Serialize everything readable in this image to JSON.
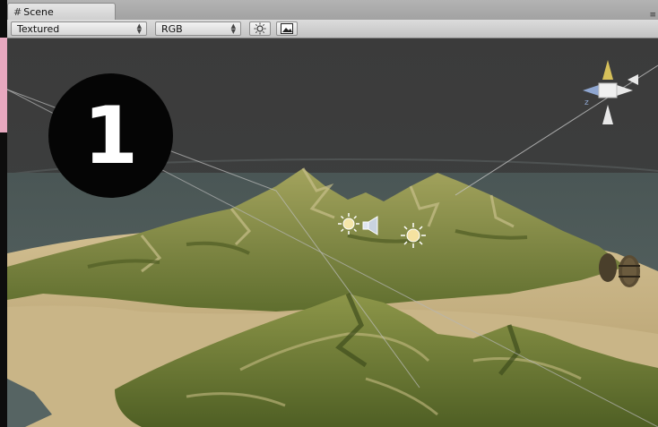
{
  "window": {
    "tab": {
      "icon": "grid-icon",
      "label": "Scene"
    },
    "toolbar": {
      "draw_mode": "Textured",
      "render_mode": "RGB",
      "lighting_toggle_icon": "sun-icon",
      "overlay_toggle_icon": "image-icon"
    }
  },
  "viewport": {
    "badge_number": "1",
    "objects": [
      "directional-light-icon",
      "audio-source-icon",
      "point-light-icon",
      "barrels"
    ],
    "gizmo": "scene-orientation-gizmo"
  },
  "colors": {
    "sky": "#3a3a3a",
    "badge": "#050505",
    "terrain": "#7c8740",
    "sand": "#c4b083"
  }
}
